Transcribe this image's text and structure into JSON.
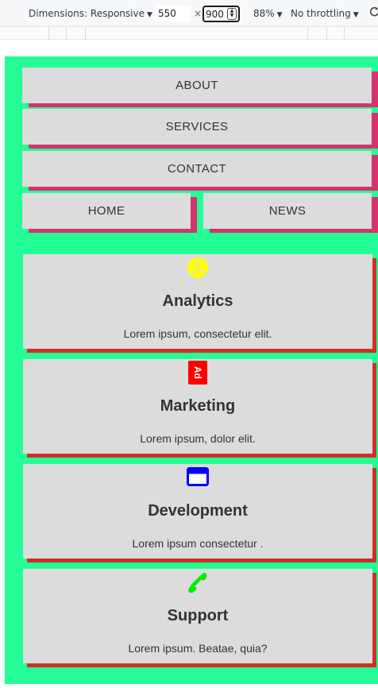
{
  "devtools": {
    "dimensions_label": "Dimensions: Responsive",
    "width_value": "550",
    "times_sign": "×",
    "height_value": "900",
    "zoom_label": "88%",
    "throttle_label": "No throttling"
  },
  "nav": {
    "about": "ABOUT",
    "services": "SERVICES",
    "contact": "CONTACT",
    "home": "HOME",
    "news": "NEWS"
  },
  "cards": [
    {
      "title": "Analytics",
      "text": "Lorem ipsum, consectetur elit.",
      "icon": "pie-chart-icon",
      "icon_color": "#ffff00"
    },
    {
      "title": "Marketing",
      "text": "Lorem ipsum, dolor elit.",
      "icon": "ad-icon",
      "icon_color": "#ff0000"
    },
    {
      "title": "Development",
      "text": "Lorem ipsum consectetur .",
      "icon": "window-icon",
      "icon_color": "#0000ff"
    },
    {
      "title": "Support",
      "text": "Lorem ipsum. Beatae, quia?",
      "icon": "phone-icon",
      "icon_color": "#00ee00"
    }
  ],
  "colors": {
    "page_background": "#24fc95",
    "nav_shadow": "#d3346e",
    "card_shadow": "#cd3029",
    "box_background": "#dcdcdc"
  }
}
